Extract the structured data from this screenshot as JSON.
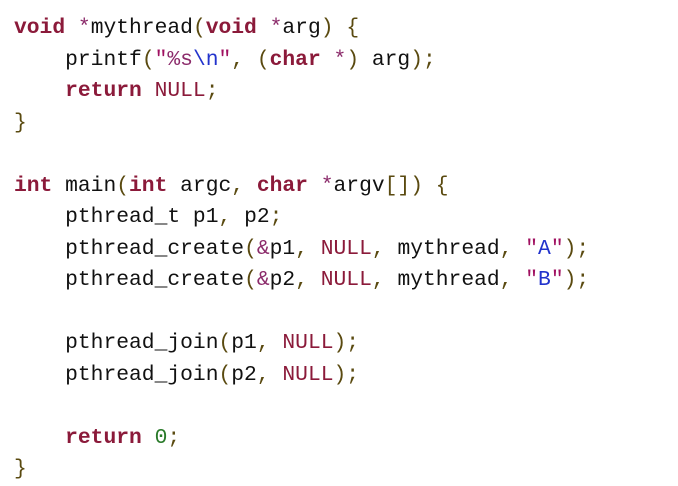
{
  "colors": {
    "keyword": "#8b1a3a",
    "plain": "#111111",
    "punct": "#5a4a10",
    "operator": "#8b2a6a",
    "string": "#a01060",
    "string_content": "#2233cc",
    "escape": "#2233cc",
    "literal": "#8b1a3a",
    "number": "#2a7a2a"
  },
  "code": {
    "lines": [
      [
        {
          "t": "void",
          "c": "keyword",
          "b": true
        },
        {
          "t": " ",
          "c": "plain"
        },
        {
          "t": "*",
          "c": "operator"
        },
        {
          "t": "mythread",
          "c": "plain"
        },
        {
          "t": "(",
          "c": "punct"
        },
        {
          "t": "void",
          "c": "keyword",
          "b": true
        },
        {
          "t": " ",
          "c": "plain"
        },
        {
          "t": "*",
          "c": "operator"
        },
        {
          "t": "arg",
          "c": "plain"
        },
        {
          "t": ")",
          "c": "punct"
        },
        {
          "t": " ",
          "c": "plain"
        },
        {
          "t": "{",
          "c": "punct"
        }
      ],
      [
        {
          "t": "    ",
          "c": "plain"
        },
        {
          "t": "printf",
          "c": "plain"
        },
        {
          "t": "(",
          "c": "punct"
        },
        {
          "t": "\"",
          "c": "string"
        },
        {
          "t": "%s",
          "c": "operator"
        },
        {
          "t": "\\n",
          "c": "escape"
        },
        {
          "t": "\"",
          "c": "string"
        },
        {
          "t": ", ",
          "c": "punct"
        },
        {
          "t": "(",
          "c": "punct"
        },
        {
          "t": "char",
          "c": "keyword",
          "b": true
        },
        {
          "t": " ",
          "c": "plain"
        },
        {
          "t": "*",
          "c": "operator"
        },
        {
          "t": ")",
          "c": "punct"
        },
        {
          "t": " ",
          "c": "plain"
        },
        {
          "t": "arg",
          "c": "plain"
        },
        {
          "t": ");",
          "c": "punct"
        }
      ],
      [
        {
          "t": "    ",
          "c": "plain"
        },
        {
          "t": "return",
          "c": "keyword",
          "b": true
        },
        {
          "t": " ",
          "c": "plain"
        },
        {
          "t": "NULL",
          "c": "literal"
        },
        {
          "t": ";",
          "c": "punct"
        }
      ],
      [
        {
          "t": "}",
          "c": "punct"
        }
      ],
      [],
      [
        {
          "t": "int",
          "c": "keyword",
          "b": true
        },
        {
          "t": " ",
          "c": "plain"
        },
        {
          "t": "main",
          "c": "plain"
        },
        {
          "t": "(",
          "c": "punct"
        },
        {
          "t": "int",
          "c": "keyword",
          "b": true
        },
        {
          "t": " ",
          "c": "plain"
        },
        {
          "t": "argc",
          "c": "plain"
        },
        {
          "t": ", ",
          "c": "punct"
        },
        {
          "t": "char",
          "c": "keyword",
          "b": true
        },
        {
          "t": " ",
          "c": "plain"
        },
        {
          "t": "*",
          "c": "operator"
        },
        {
          "t": "argv",
          "c": "plain"
        },
        {
          "t": "[]",
          "c": "punct"
        },
        {
          "t": ")",
          "c": "punct"
        },
        {
          "t": " ",
          "c": "plain"
        },
        {
          "t": "{",
          "c": "punct"
        }
      ],
      [
        {
          "t": "    ",
          "c": "plain"
        },
        {
          "t": "pthread_t p1",
          "c": "plain"
        },
        {
          "t": ", ",
          "c": "punct"
        },
        {
          "t": "p2",
          "c": "plain"
        },
        {
          "t": ";",
          "c": "punct"
        }
      ],
      [
        {
          "t": "    ",
          "c": "plain"
        },
        {
          "t": "pthread_create",
          "c": "plain"
        },
        {
          "t": "(",
          "c": "punct"
        },
        {
          "t": "&",
          "c": "operator"
        },
        {
          "t": "p1",
          "c": "plain"
        },
        {
          "t": ", ",
          "c": "punct"
        },
        {
          "t": "NULL",
          "c": "literal"
        },
        {
          "t": ", ",
          "c": "punct"
        },
        {
          "t": "mythread",
          "c": "plain"
        },
        {
          "t": ", ",
          "c": "punct"
        },
        {
          "t": "\"",
          "c": "string"
        },
        {
          "t": "A",
          "c": "string_content"
        },
        {
          "t": "\"",
          "c": "string"
        },
        {
          "t": ");",
          "c": "punct"
        }
      ],
      [
        {
          "t": "    ",
          "c": "plain"
        },
        {
          "t": "pthread_create",
          "c": "plain"
        },
        {
          "t": "(",
          "c": "punct"
        },
        {
          "t": "&",
          "c": "operator"
        },
        {
          "t": "p2",
          "c": "plain"
        },
        {
          "t": ", ",
          "c": "punct"
        },
        {
          "t": "NULL",
          "c": "literal"
        },
        {
          "t": ", ",
          "c": "punct"
        },
        {
          "t": "mythread",
          "c": "plain"
        },
        {
          "t": ", ",
          "c": "punct"
        },
        {
          "t": "\"",
          "c": "string"
        },
        {
          "t": "B",
          "c": "string_content"
        },
        {
          "t": "\"",
          "c": "string"
        },
        {
          "t": ");",
          "c": "punct"
        }
      ],
      [],
      [
        {
          "t": "    ",
          "c": "plain"
        },
        {
          "t": "pthread_join",
          "c": "plain"
        },
        {
          "t": "(",
          "c": "punct"
        },
        {
          "t": "p1",
          "c": "plain"
        },
        {
          "t": ", ",
          "c": "punct"
        },
        {
          "t": "NULL",
          "c": "literal"
        },
        {
          "t": ");",
          "c": "punct"
        }
      ],
      [
        {
          "t": "    ",
          "c": "plain"
        },
        {
          "t": "pthread_join",
          "c": "plain"
        },
        {
          "t": "(",
          "c": "punct"
        },
        {
          "t": "p2",
          "c": "plain"
        },
        {
          "t": ", ",
          "c": "punct"
        },
        {
          "t": "NULL",
          "c": "literal"
        },
        {
          "t": ");",
          "c": "punct"
        }
      ],
      [],
      [
        {
          "t": "    ",
          "c": "plain"
        },
        {
          "t": "return",
          "c": "keyword",
          "b": true
        },
        {
          "t": " ",
          "c": "plain"
        },
        {
          "t": "0",
          "c": "number"
        },
        {
          "t": ";",
          "c": "punct"
        }
      ],
      [
        {
          "t": "}",
          "c": "punct"
        }
      ]
    ]
  }
}
